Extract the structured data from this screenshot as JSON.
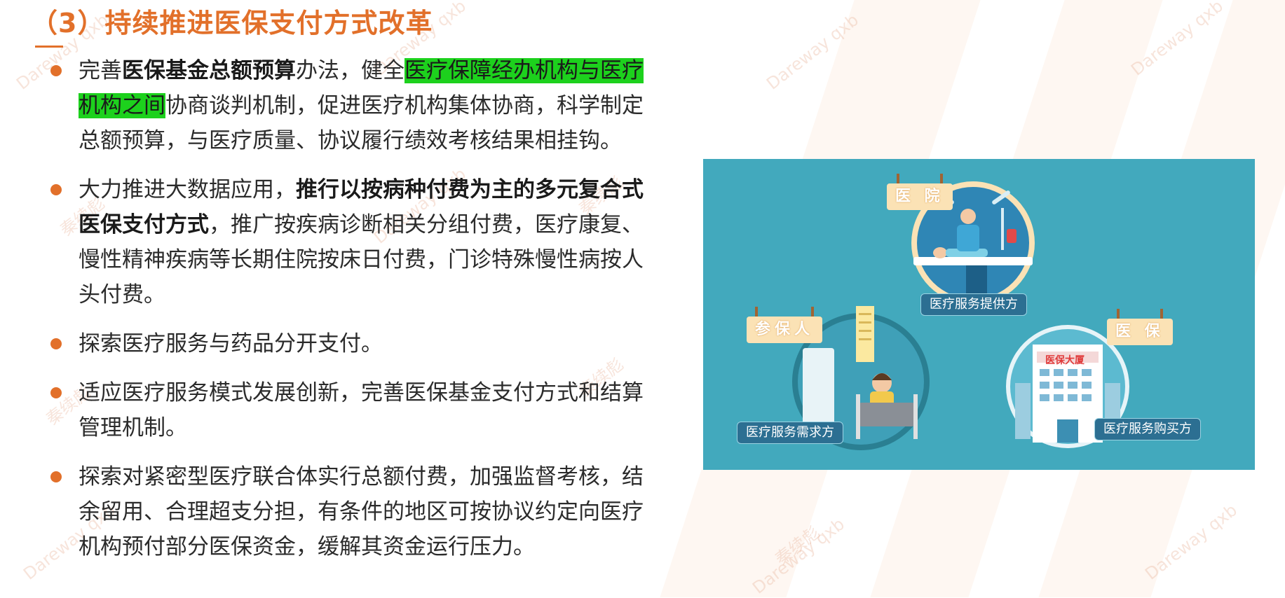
{
  "page": {
    "title": "（3）持续推进医保支付方式改革"
  },
  "bullets": [
    {
      "segments": [
        {
          "text": "完善",
          "style": "normal"
        },
        {
          "text": "医保基金总额预算",
          "style": "bold"
        },
        {
          "text": "办法，健全",
          "style": "normal"
        },
        {
          "text": "医疗保障经办机构与医疗机构之间",
          "style": "highlight"
        },
        {
          "text": "协商谈判机制，促进医疗机构集体协商，科学制定总额预算，与医疗质量、协议履行绩效考核结果相挂钩。",
          "style": "normal"
        }
      ]
    },
    {
      "segments": [
        {
          "text": "大力推进大数据应用，",
          "style": "normal"
        },
        {
          "text": "推行以按病种付费为主的多元复合式医保支付方式",
          "style": "bold"
        },
        {
          "text": "，推广按疾病诊断相关分组付费，医疗康复、慢性精神疾病等长期住院按床日付费，门诊特殊慢性病按人头付费。",
          "style": "normal"
        }
      ]
    },
    {
      "segments": [
        {
          "text": "探索医疗服务与药品分开支付。",
          "style": "normal"
        }
      ]
    },
    {
      "segments": [
        {
          "text": "适应医疗服务模式发展创新，完善医保基金支付方式和结算管理机制。",
          "style": "normal"
        }
      ]
    },
    {
      "segments": [
        {
          "text": "探索对紧密型医疗联合体实行总额付费，加强监督考核，结余留用、合理超支分担，有条件的地区可按协议约定向医疗机构预付部分医保资金，缓解其资金运行压力。",
          "style": "normal"
        }
      ]
    }
  ],
  "illustration": {
    "hospital": {
      "sign": "医 院",
      "role": "医疗服务提供方"
    },
    "insured": {
      "sign": "参保人",
      "role": "医疗服务需求方"
    },
    "insurance": {
      "sign": "医 保",
      "role": "医疗服务购买方",
      "building_name": "医保大厦"
    }
  },
  "watermark": {
    "texts": [
      "Dareway qxb",
      "秦续彪"
    ]
  },
  "colors": {
    "accent": "#e2702a",
    "highlight": "#1dd11d",
    "illustration_bg": "#42a9bd",
    "sign_bg": "#fbe2b5",
    "role_bg": "#2c6f92"
  }
}
